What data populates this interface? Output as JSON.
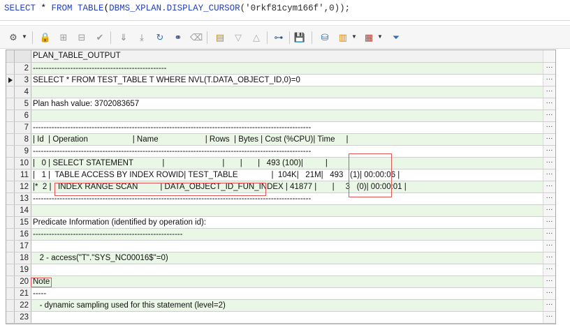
{
  "editor": {
    "kw_select": "SELECT",
    "star": " * ",
    "kw_from": "FROM",
    "fn_table": " TABLE",
    "paren_open": "(",
    "fn_display": "DBMS_XPLAN.DISPLAY_CURSOR",
    "args": "('0rkf81cym166f',0));"
  },
  "toolbar": {
    "icons": [
      "grid-settings-icon",
      "lock-icon",
      "add-row-icon",
      "delete-row-icon",
      "check-icon",
      "filter-down-icon",
      "filter-first-icon",
      "refresh-icon",
      "binoculars-search-icon",
      "eraser-icon",
      "export-icon",
      "move-down-icon",
      "move-up-icon",
      "tree-icon",
      "save-icon",
      "database-icon",
      "chart-icon",
      "table-grid-icon",
      "funnel-filter-icon"
    ]
  },
  "grid": {
    "column_header": "PLAN_TABLE_OUTPUT",
    "ellipsis": "···",
    "rows": [
      {
        "num": "2",
        "text": "--------------------------------------------------"
      },
      {
        "num": "3",
        "text": "SELECT * FROM TEST_TABLE T WHERE NVL(T.DATA_OBJECT_ID,0)=0"
      },
      {
        "num": "4",
        "text": ""
      },
      {
        "num": "5",
        "text": "Plan hash value: 3702083657"
      },
      {
        "num": "6",
        "text": ""
      },
      {
        "num": "7",
        "text": "--------------------------------------------------------------------------------------------------------"
      },
      {
        "num": "8",
        "text": "| Id  | Operation                    | Name                     | Rows  | Bytes | Cost (%CPU)| Time     |"
      },
      {
        "num": "9",
        "text": "--------------------------------------------------------------------------------------------------------"
      },
      {
        "num": "10",
        "text": "|   0 | SELECT STATEMENT             |                          |       |       |   493 (100)|          |"
      },
      {
        "num": "11",
        "text": "|   1 |  TABLE ACCESS BY INDEX ROWID| TEST_TABLE               |  104K|   21M|   493   (1)| 00:00:06 |"
      },
      {
        "num": "12",
        "text": "|*  2 |   INDEX RANGE SCAN          | DATA_OBJECT_ID_FUN_INDEX | 41877 |       |     3   (0)| 00:00:01 |"
      },
      {
        "num": "13",
        "text": "--------------------------------------------------------------------------------------------------------"
      },
      {
        "num": "14",
        "text": ""
      },
      {
        "num": "15",
        "text": "Predicate Information (identified by operation id):"
      },
      {
        "num": "16",
        "text": "--------------------------------------------------------"
      },
      {
        "num": "17",
        "text": ""
      },
      {
        "num": "18",
        "text": "   2 - access(\"T\".\"SYS_NC00016$\"=0)"
      },
      {
        "num": "19",
        "text": ""
      },
      {
        "num": "20",
        "text": "Note"
      },
      {
        "num": "21",
        "text": "-----"
      },
      {
        "num": "22",
        "text": "   - dynamic sampling used for this statement (level=2)"
      },
      {
        "num": "23",
        "text": ""
      }
    ]
  },
  "colors": {
    "keyword": "#1f3fc4",
    "alt_row": "#eaf6e6",
    "highlight_box": "#e05555"
  }
}
